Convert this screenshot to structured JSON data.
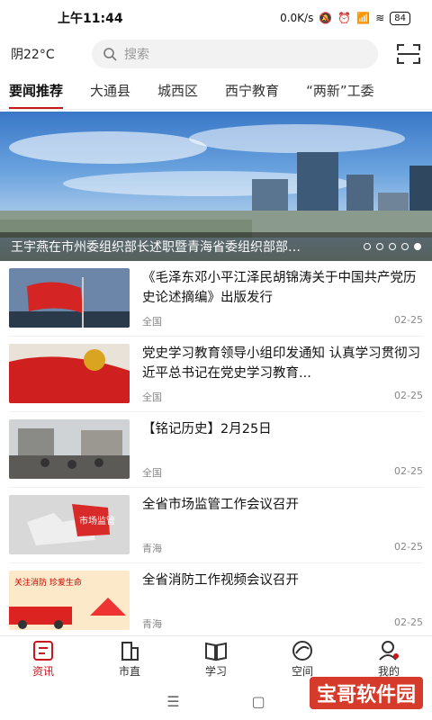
{
  "status": {
    "time": "上午11:44",
    "speed": "0.0K/s",
    "battery": "84"
  },
  "header": {
    "weather": "阴22°C",
    "search_placeholder": "搜索"
  },
  "tabs": [
    {
      "label": "要闻推荐",
      "active": true
    },
    {
      "label": "大通县"
    },
    {
      "label": "城西区"
    },
    {
      "label": "西宁教育"
    },
    {
      "label": "“两新”工委"
    }
  ],
  "banner": {
    "caption": "王宇燕在市州委组织部长述职暨青海省委组织部部…",
    "slides": 5,
    "active_slide": 5
  },
  "news": [
    {
      "title": "《毛泽东邓小平江泽民胡锦涛关于中国共产党历史论述摘编》出版发行",
      "source": "全国",
      "date": "02-25"
    },
    {
      "title": "党史学习教育领导小组印发通知 认真学习贯彻习近平总书记在党史学习教育...",
      "source": "全国",
      "date": "02-25"
    },
    {
      "title": "【铭记历史】2月25日",
      "source": "全国",
      "date": "02-25"
    },
    {
      "title": "全省市场监管工作会议召开",
      "source": "青海",
      "date": "02-25"
    },
    {
      "title": "全省消防工作视频会议召开",
      "source": "青海",
      "date": "02-25"
    }
  ],
  "bottom_nav": [
    {
      "label": "资讯",
      "active": true,
      "icon": "news-icon"
    },
    {
      "label": "市直",
      "icon": "building-icon"
    },
    {
      "label": "学习",
      "icon": "book-icon"
    },
    {
      "label": "空间",
      "icon": "space-icon"
    },
    {
      "label": "我的",
      "icon": "profile-icon"
    }
  ],
  "thumb_texts": {
    "puzzle": "市场监管",
    "fire": "关注消防 珍爱生命"
  },
  "watermark": "宝哥软件园",
  "colors": {
    "accent": "#c8161d"
  }
}
